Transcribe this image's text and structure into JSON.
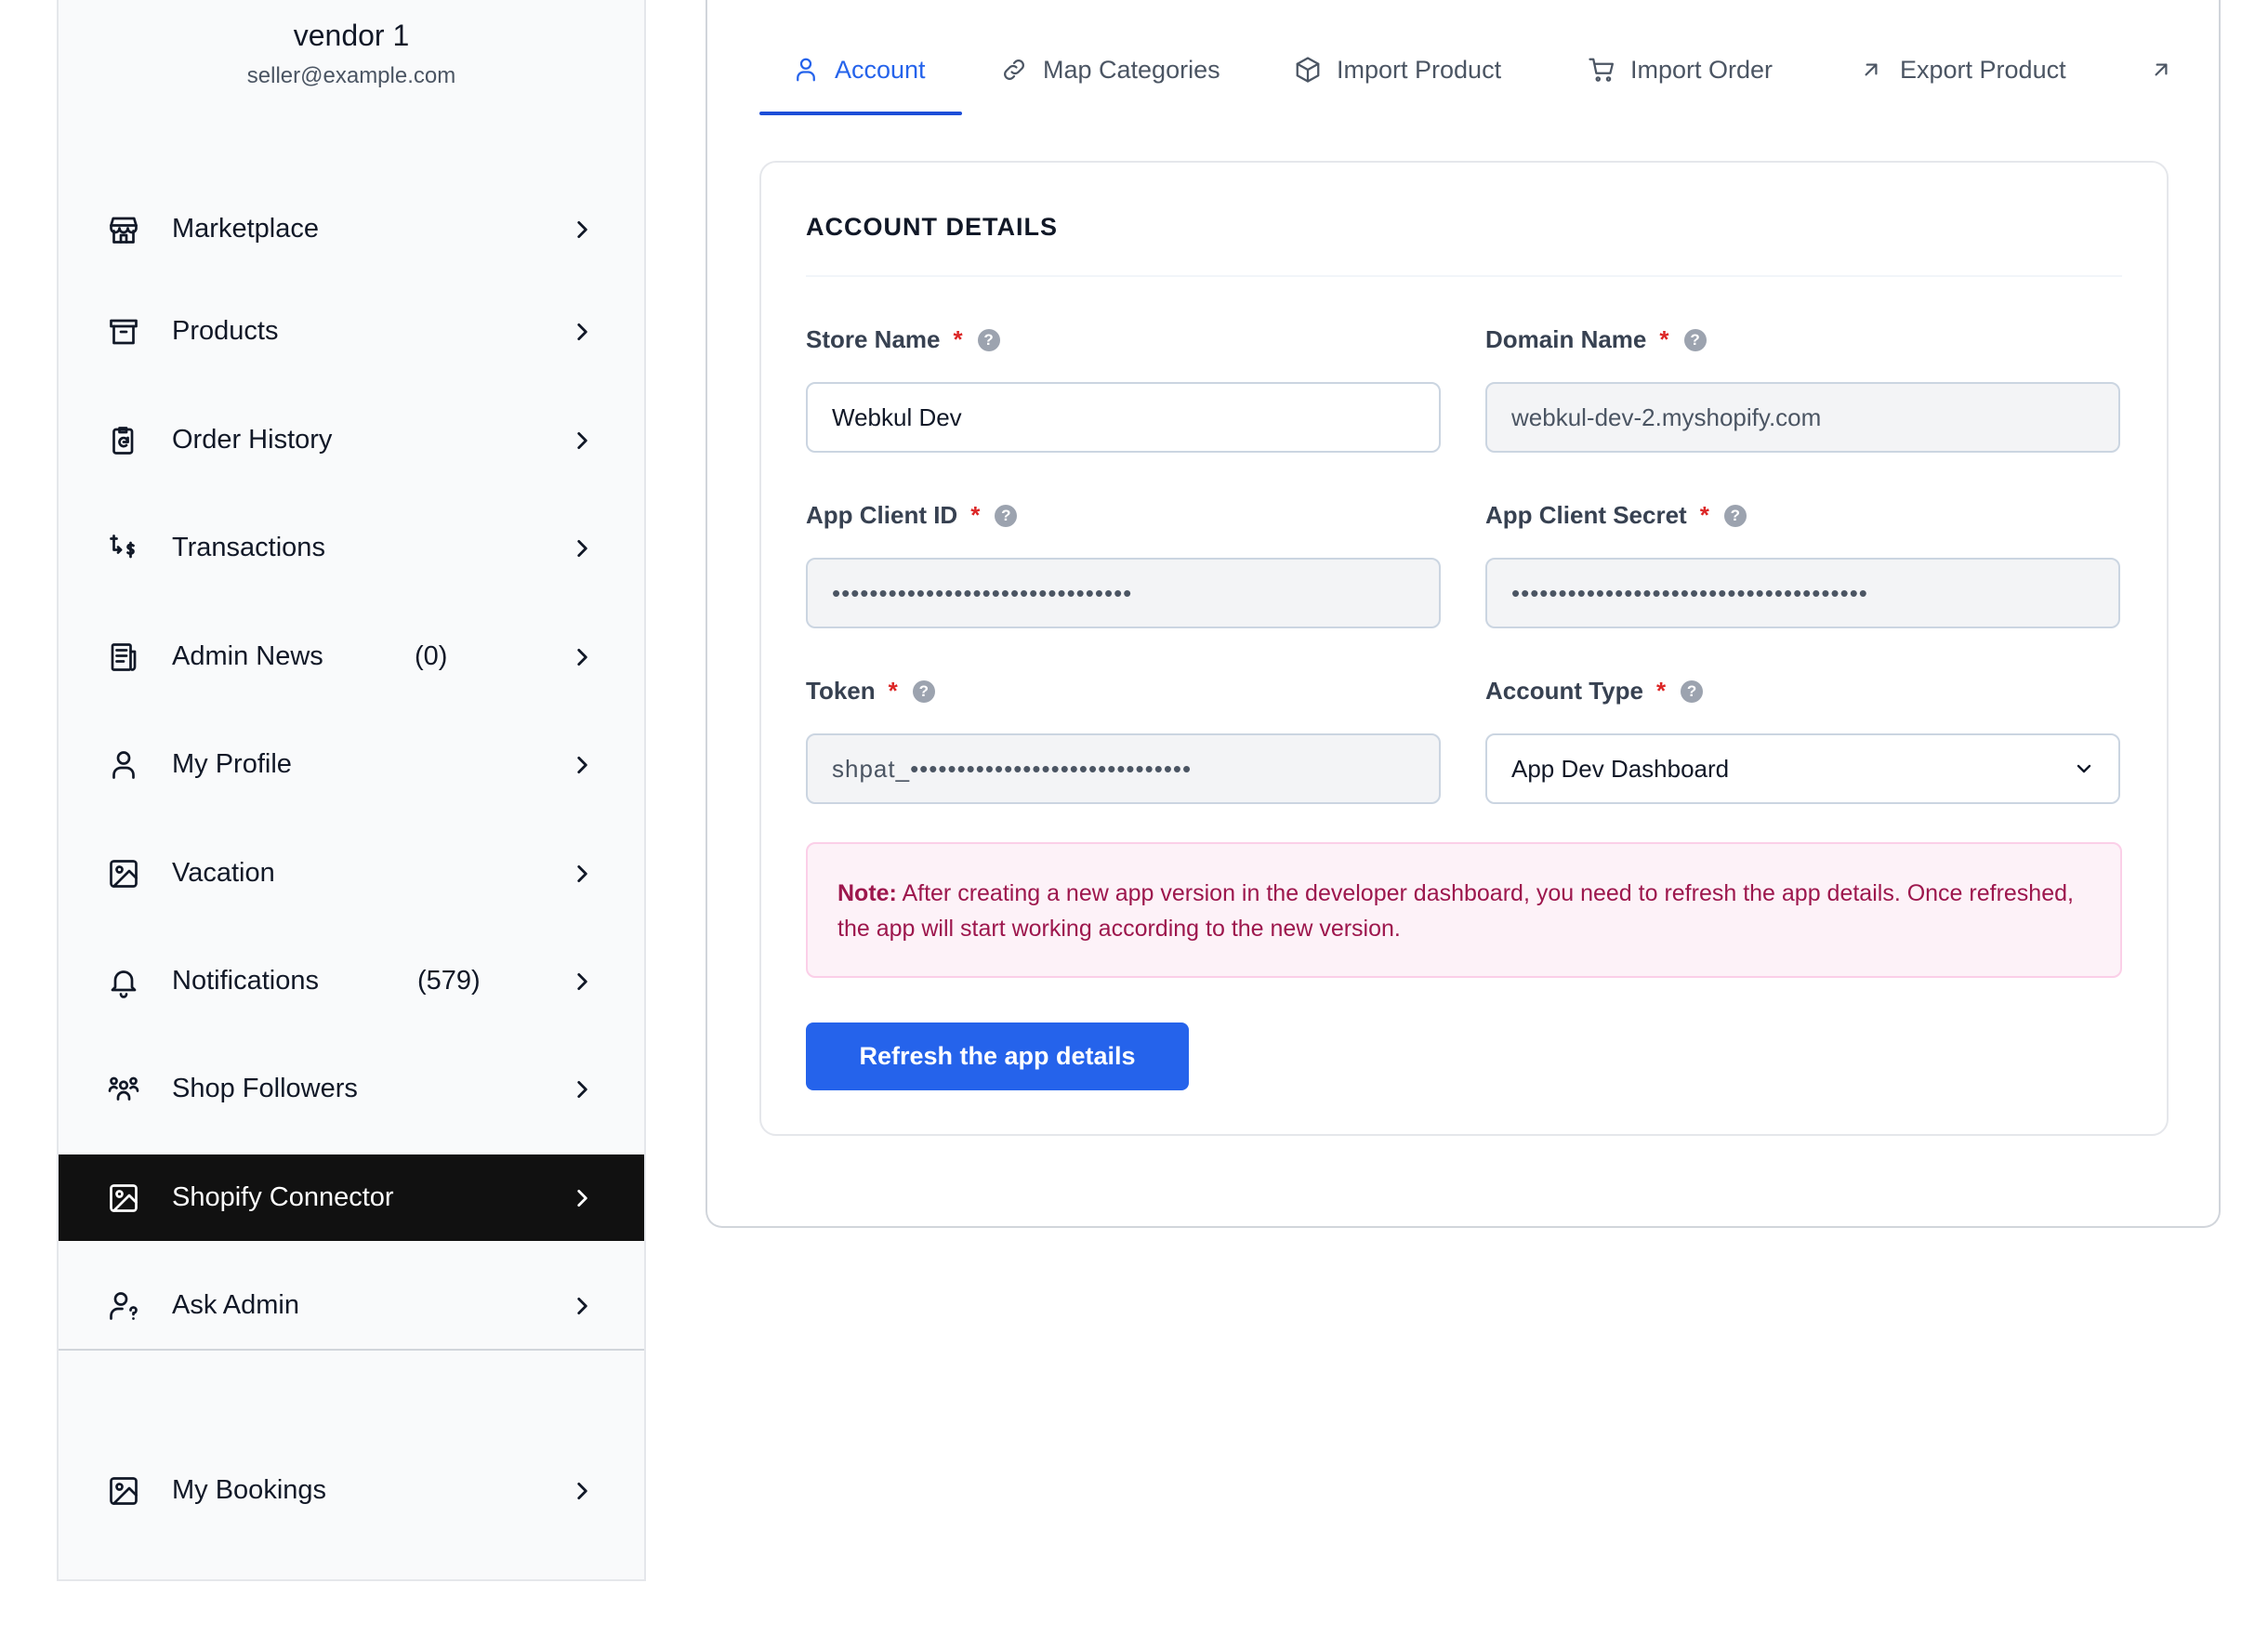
{
  "vendor": {
    "name": "vendor 1",
    "email": "seller@example.com"
  },
  "sidebar": {
    "items": [
      {
        "label": "Marketplace",
        "icon": "store-icon"
      },
      {
        "label": "Products",
        "icon": "archive-icon"
      },
      {
        "label": "Order History",
        "icon": "clipboard-refresh-icon"
      },
      {
        "label": "Transactions",
        "icon": "transactions-icon"
      },
      {
        "label": "Admin News",
        "icon": "news-icon",
        "count": "(0)"
      },
      {
        "label": "My Profile",
        "icon": "user-icon"
      },
      {
        "label": "Vacation",
        "icon": "image-icon"
      },
      {
        "label": "Notifications",
        "icon": "bell-icon",
        "count": "(579)"
      },
      {
        "label": "Shop Followers",
        "icon": "users-icon"
      },
      {
        "label": "Shopify Connector",
        "icon": "image-icon",
        "active": true
      },
      {
        "label": "Ask Admin",
        "icon": "user-question-icon"
      },
      {
        "label": "My Bookings",
        "icon": "image-icon"
      }
    ]
  },
  "tabs": [
    {
      "label": "Account",
      "icon": "user-icon",
      "active": true
    },
    {
      "label": "Map Categories",
      "icon": "link-icon"
    },
    {
      "label": "Import Product",
      "icon": "cube-icon"
    },
    {
      "label": "Import Order",
      "icon": "cart-icon"
    },
    {
      "label": "Export Product",
      "icon": "arrow-up-right-icon"
    },
    {
      "label": "",
      "icon": "arrow-up-right-icon"
    }
  ],
  "account": {
    "title": "ACCOUNT DETAILS",
    "store_name": {
      "label": "Store Name",
      "value": "Webkul Dev"
    },
    "domain_name": {
      "label": "Domain Name",
      "value": "webkul-dev-2.myshopify.com"
    },
    "client_id": {
      "label": "App Client ID",
      "value": "••••••••••••••••••••••••••••••••"
    },
    "client_secret": {
      "label": "App Client Secret",
      "value": "••••••••••••••••••••••••••••••••••••••"
    },
    "token": {
      "label": "Token",
      "value": "shpat_••••••••••••••••••••••••••••••"
    },
    "account_type": {
      "label": "Account Type",
      "value": "App Dev Dashboard"
    },
    "required_mark": "*",
    "help_mark": "?",
    "note": {
      "prefix": "Note:",
      "text": " After creating a new app version in the developer dashboard, you need to refresh the app details. Once refreshed, the app will start working according to the new version."
    },
    "refresh_button": "Refresh the app details"
  },
  "colors": {
    "accent": "#2563eb",
    "active_nav_bg": "#111111",
    "note_text": "#9d174d",
    "required": "#dc2626"
  }
}
